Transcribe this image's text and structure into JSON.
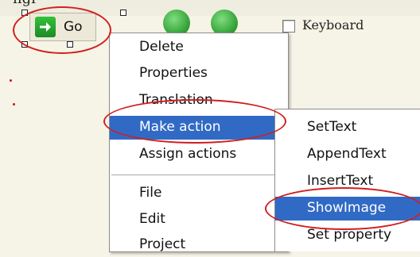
{
  "designer": {
    "cut_text": "ngi",
    "go_button": {
      "label": "Go",
      "icon": "arrow-right-icon"
    },
    "toolbar_icons": [
      "green-circle-icon",
      "green-circle-icon"
    ],
    "keyboard_checkbox": {
      "label": "Keyboard",
      "checked": false
    }
  },
  "context_menu": {
    "items": [
      {
        "label": "Delete"
      },
      {
        "label": "Properties"
      },
      {
        "label": "Translation"
      },
      {
        "label": "Make action",
        "has_submenu": true,
        "highlighted": true
      },
      {
        "label": "Assign actions",
        "has_submenu": true
      },
      {
        "label": "File",
        "has_submenu": true
      },
      {
        "label": "Edit",
        "has_submenu": true
      },
      {
        "label": "Project",
        "has_submenu": true
      }
    ]
  },
  "submenu": {
    "items": [
      {
        "label": "SetText"
      },
      {
        "label": "AppendText"
      },
      {
        "label": "InsertText"
      },
      {
        "label": "ShowImage",
        "highlighted": true
      },
      {
        "label": "Set property"
      }
    ]
  },
  "colors": {
    "highlight": "#316ac5",
    "annotation_red": "#d02020",
    "go_arrow_green": "#27a32f"
  }
}
